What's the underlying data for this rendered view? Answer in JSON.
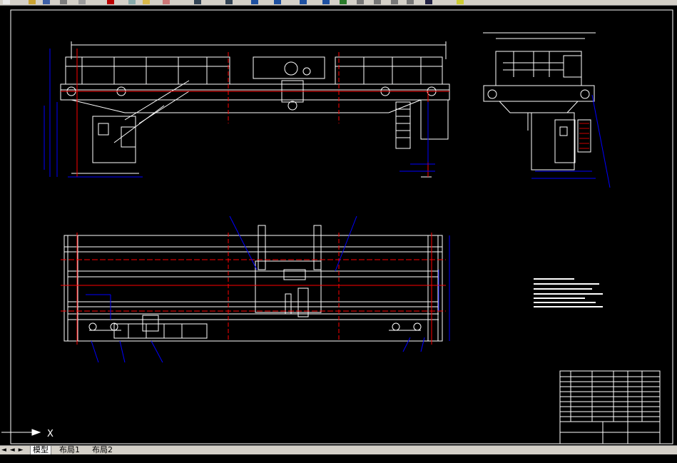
{
  "toolbar": {
    "icons": [
      "new-icon",
      "open-icon",
      "save-icon",
      "print-icon",
      "preview-icon",
      "cut-icon",
      "copy-icon",
      "paste-icon",
      "match-properties-icon",
      "undo-icon",
      "redo-icon",
      "pan-icon",
      "zoom-realtime-icon",
      "zoom-window-icon",
      "zoom-previous-icon",
      "properties-icon",
      "design-center-icon",
      "tool-palettes-icon",
      "sheet-set-icon",
      "markup-icon",
      "calculator-icon",
      "help-icon"
    ]
  },
  "ucs": {
    "x_label": "X"
  },
  "tabs": {
    "nav": "◄ ◄ ► ►",
    "items": [
      {
        "label": "模型",
        "active": true
      },
      {
        "label": "布局1",
        "active": false
      },
      {
        "label": "布局2",
        "active": false
      }
    ]
  },
  "colors": {
    "background": "#000000",
    "lines": "#ffffff",
    "centerlines": "#ff0000",
    "dimensions": "#0000ff",
    "border": "#ffffff"
  },
  "title_block": {
    "rows": 11
  }
}
